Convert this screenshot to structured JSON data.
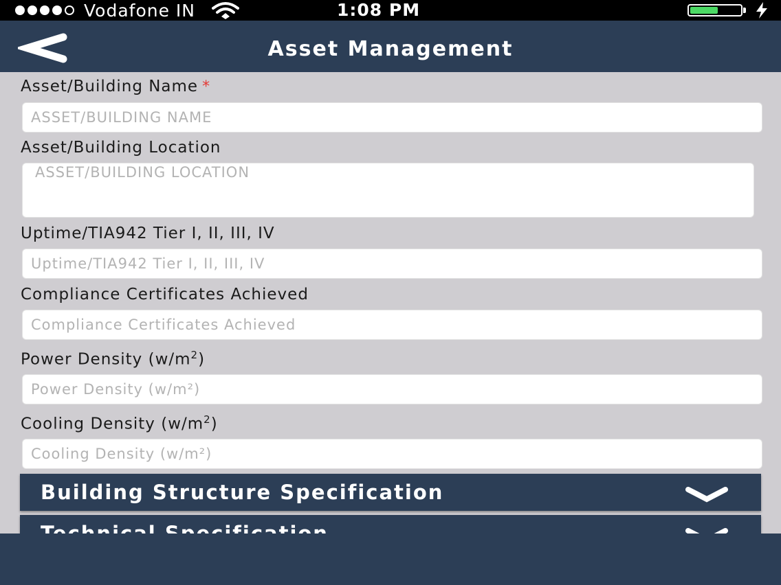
{
  "status_bar": {
    "carrier": "Vodafone IN",
    "time": "1:08 PM",
    "battery_level": 0.55,
    "signal_bars_filled": 4,
    "signal_bars_total": 5,
    "icons": [
      "signal-dots-icon",
      "wifi-icon",
      "battery-icon",
      "charging-bolt-icon"
    ]
  },
  "header": {
    "title": "Asset Management",
    "back_icon": "chevron-left-icon"
  },
  "form": {
    "asset_name": {
      "label": "Asset/Building Name",
      "required_mark": "*",
      "placeholder": "ASSET/BUILDING NAME",
      "value": ""
    },
    "asset_location": {
      "label": "Asset/Building Location",
      "placeholder": "ASSET/BUILDING LOCATION",
      "value": ""
    },
    "uptime_tier": {
      "label": "Uptime/TIA942 Tier I, II, III, IV",
      "placeholder": "Uptime/TIA942 Tier I, II, III, IV",
      "value": ""
    },
    "compliance": {
      "label": "Compliance Certificates Achieved",
      "placeholder": "Compliance Certificates Achieved",
      "value": ""
    },
    "power_density": {
      "label_text": "Power Density (w/m",
      "label_sup": "2",
      "label_close": ")",
      "placeholder": "Power Density (w/m²)",
      "value": ""
    },
    "cooling_density": {
      "label_text": "Cooling Density (w/m",
      "label_sup": "2",
      "label_close": ")",
      "placeholder": "Cooling Density (w/m²)",
      "value": ""
    }
  },
  "sections": [
    {
      "title": "Building Structure Specification",
      "icon": "chevron-down-icon"
    },
    {
      "title": "Technical Specification",
      "icon": "chevron-down-icon"
    }
  ],
  "colors": {
    "nav": "#2c3e56",
    "background": "#cfcdd1",
    "required": "#e53935",
    "battery": "#4cd964"
  }
}
